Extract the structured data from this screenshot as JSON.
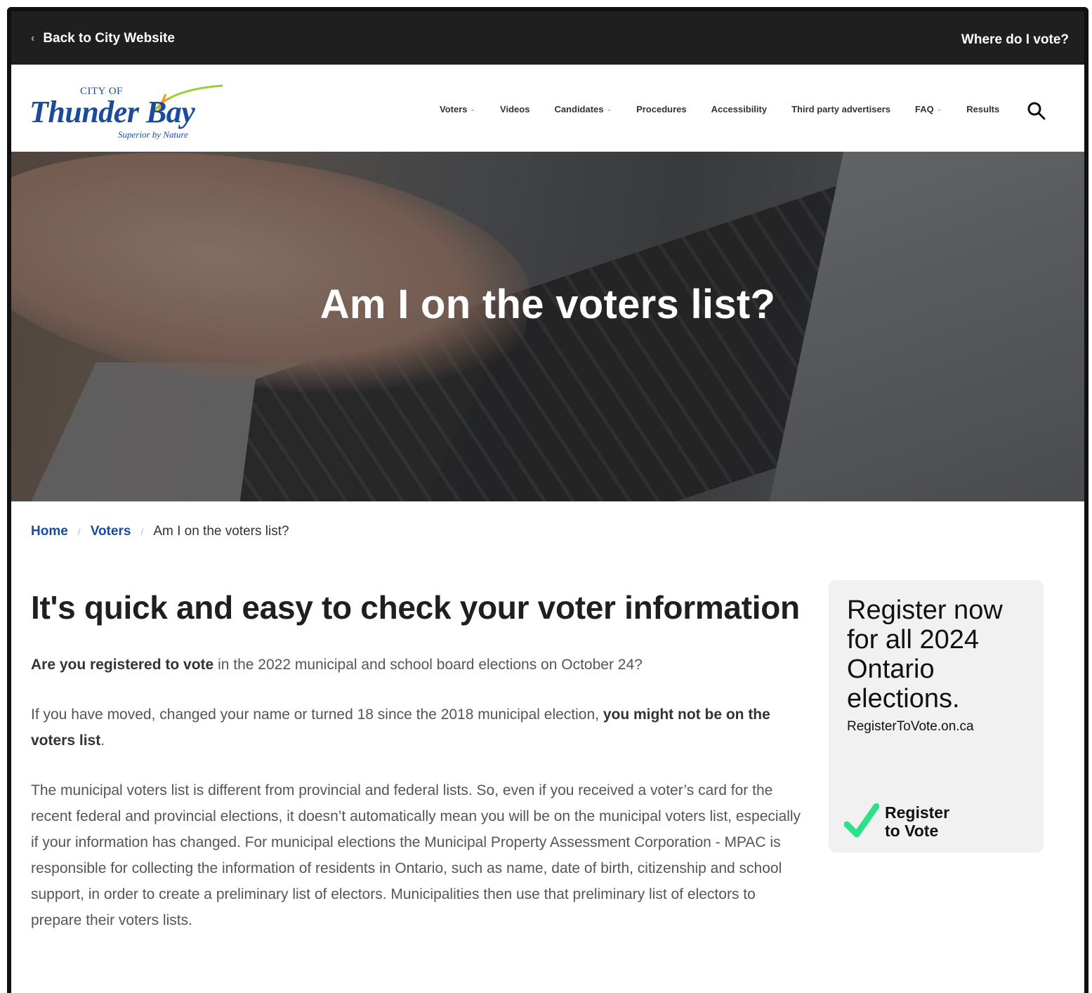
{
  "topbar": {
    "back_label": "Back to City Website",
    "where_label": "Where do I vote?"
  },
  "logo": {
    "city_of": "CITY OF",
    "name": "Thunder Bay",
    "tagline": "Superior by Nature"
  },
  "nav": {
    "items": [
      {
        "label": "Voters",
        "has_dropdown": true
      },
      {
        "label": "Videos",
        "has_dropdown": false
      },
      {
        "label": "Candidates",
        "has_dropdown": true
      },
      {
        "label": "Procedures",
        "has_dropdown": false
      },
      {
        "label": "Accessibility",
        "has_dropdown": false
      },
      {
        "label": "Third party advertisers",
        "has_dropdown": false
      },
      {
        "label": "FAQ",
        "has_dropdown": true
      },
      {
        "label": "Results",
        "has_dropdown": false
      }
    ],
    "search_icon": "search-icon"
  },
  "hero": {
    "title": "Am I on the voters list?"
  },
  "breadcrumb": {
    "home": "Home",
    "voters": "Voters",
    "current": "Am I on the voters list?"
  },
  "main": {
    "heading": "It's quick and easy to check your voter information",
    "p1_bold": "Are you registered to vote",
    "p1_rest": " in the 2022 municipal and school board elections on October 24?",
    "p2_start": "If you have moved, changed your name or turned 18 since the 2018 municipal election, ",
    "p2_bold": "you might not be on the voters list",
    "p2_end": ".",
    "p3": "The municipal voters list is different from provincial and federal lists. So, even if you received a voter’s card for the recent federal and provincial elections, it doesn’t automatically mean you will be on the municipal voters list, especially if your information has changed. For municipal elections the Municipal Property Assessment Corporation - MPAC is responsible for collecting the information of residents in Ontario, such as name, date of birth, citizenship and school support, in order to create a preliminary list of electors. Municipalities then use that preliminary list of electors to prepare their voters lists."
  },
  "sidebar_card": {
    "headline": "Register now for all 2024 Ontario elections.",
    "url": "RegisterToVote.on.ca",
    "logo_line1": "Register",
    "logo_line2": "to Vote"
  },
  "colors": {
    "topbar_bg": "#1f1f1f",
    "link_blue": "#1b4c9c",
    "card_bg": "#f1f1f1",
    "check_green": "#2ee08a"
  }
}
